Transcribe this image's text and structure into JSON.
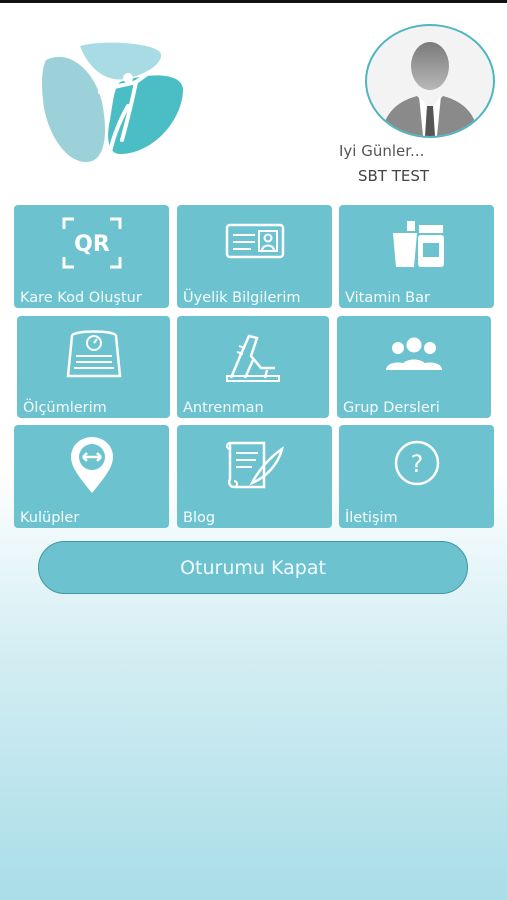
{
  "header": {
    "greeting": "Iyi Günler...",
    "user_name": "SBT TEST"
  },
  "menu": [
    {
      "label": "Kare Kod Oluştur",
      "icon": "qr-code-icon"
    },
    {
      "label": "Üyelik Bilgilerim",
      "icon": "id-card-icon"
    },
    {
      "label": "Vitamin Bar",
      "icon": "drink-jar-icon"
    },
    {
      "label": "Ölçümlerim",
      "icon": "scale-icon"
    },
    {
      "label": "Antrenman",
      "icon": "running-legs-icon"
    },
    {
      "label": "Grup Dersleri",
      "icon": "group-icon"
    },
    {
      "label": "Kulüpler",
      "icon": "location-pin-icon"
    },
    {
      "label": "Blog",
      "icon": "scroll-pen-icon"
    },
    {
      "label": "İletişim",
      "icon": "question-icon"
    }
  ],
  "logout_label": "Oturumu Kapat",
  "colors": {
    "tile": "#6cc3cf",
    "logo_light": "#a8dbe3",
    "logo_dark": "#4bbec5"
  }
}
